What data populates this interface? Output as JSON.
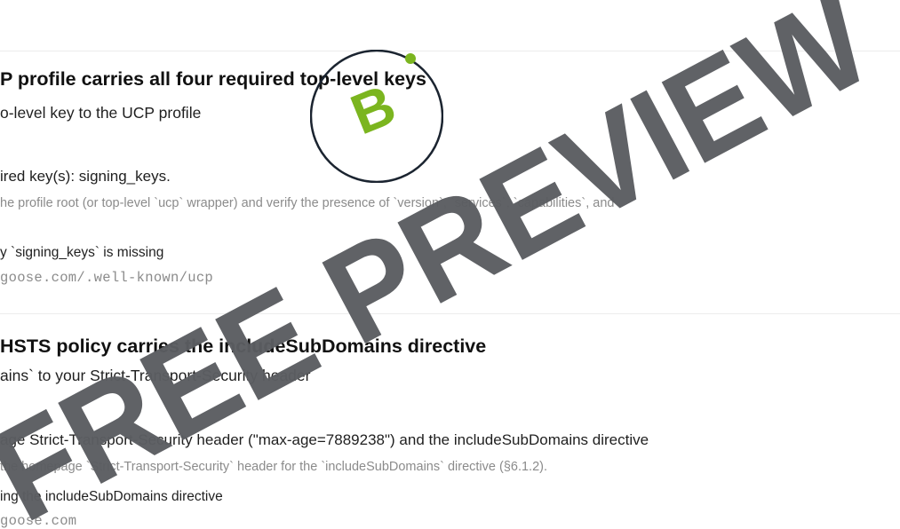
{
  "check1": {
    "title": "P profile carries all four required top-level keys",
    "action": "o-level key to the UCP profile",
    "detail": "ired key(s): signing_keys.",
    "method": "he profile root (or top-level `ucp` wrapper) and verify the presence of `version`, `services`, `capabilities`, and",
    "evidence": "y `signing_keys` is missing",
    "url": "goose.com/.well-known/ucp"
  },
  "check2": {
    "title": "HSTS policy carries the includeSubDomains directive",
    "action": "ains` to your Strict-Transport-Security header",
    "detail": "age Strict-Transport-Security header (\"max-age=7889238\") and the includeSubDomains directive",
    "method": "the homepage `Strict-Transport-Security` header for the `includeSubDomains` directive (§6.1.2).",
    "evidence": "ing the includeSubDomains directive",
    "url": "goose.com"
  },
  "badge": {
    "letter": "B",
    "color": "#7bb51f"
  },
  "watermark": {
    "text": "FREE PREVIEW",
    "color": "#5b5d61"
  }
}
